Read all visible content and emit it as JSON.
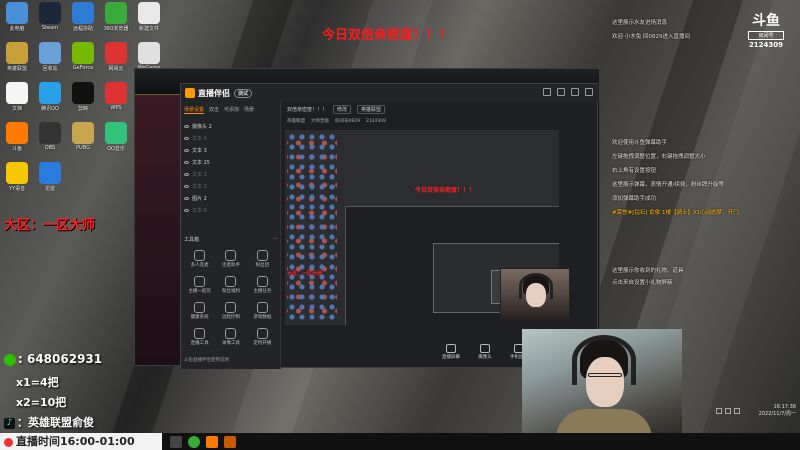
{
  "overlays": {
    "red_banner": "今日双倍亲密度！！！",
    "server_region": "大区：一区大师",
    "qq_group": ": 648062931",
    "kills_rule_1": "x1=4把",
    "kills_rule_2": "x2=10把",
    "tiktok_name": "：英雄联盟俞俊",
    "live_time": "直播时间16:00-01:00"
  },
  "desktop_icons": [
    {
      "label": "此电脑",
      "color": "#4a90d9"
    },
    {
      "label": "Steam",
      "color": "#1b2838"
    },
    {
      "label": "远程协助",
      "color": "#2d7bd4"
    },
    {
      "label": "360浏览器",
      "color": "#3aaa3a"
    },
    {
      "label": "新建文件",
      "color": "#e8e8e8"
    },
    {
      "label": "英雄联盟",
      "color": "#c8a03a"
    },
    {
      "label": "回收站",
      "color": "#6aa0d8"
    },
    {
      "label": "GeForce",
      "color": "#76b900"
    },
    {
      "label": "网易云",
      "color": "#d33"
    },
    {
      "label": "WeGame",
      "color": "#e0e0e0"
    },
    {
      "label": "文档",
      "color": "#f5f5f5"
    },
    {
      "label": "腾讯QQ",
      "color": "#2aa0e8"
    },
    {
      "label": "剪映",
      "color": "#111"
    },
    {
      "label": "WPS",
      "color": "#d33"
    },
    {
      "label": "微信",
      "color": "#2dc100"
    },
    {
      "label": "斗鱼",
      "color": "#ff7a00"
    },
    {
      "label": "OBS",
      "color": "#333"
    },
    {
      "label": "PUBG",
      "color": "#c8a650"
    },
    {
      "label": "QQ音乐",
      "color": "#31c27c"
    },
    {
      "label": "网易UU",
      "color": "#2c6ad8"
    },
    {
      "label": "YY语音",
      "color": "#f7c800"
    },
    {
      "label": "迅雷",
      "color": "#2a7ae0"
    }
  ],
  "app": {
    "logo": "直播伴侣",
    "version": "测试",
    "tabs": [
      "场景设置",
      "双击",
      "可添加",
      "场景"
    ],
    "sources": [
      {
        "label": "摄像头 2",
        "dim": false
      },
      {
        "label": "文本 4",
        "dim": true
      },
      {
        "label": "文本 3",
        "dim": false
      },
      {
        "label": "文本 25",
        "dim": false
      },
      {
        "label": "文本 1",
        "dim": true
      },
      {
        "label": "文本 2",
        "dim": true
      },
      {
        "label": "图片 2",
        "dim": false
      },
      {
        "label": "文本 6",
        "dim": true
      }
    ],
    "tools_heading": "工具箱",
    "tools": [
      "多人连麦",
      "连麦助手",
      "粉丝团",
      "主播一起玩",
      "粉丝福利",
      "主播任务",
      "健康系统",
      "远程控制",
      "游戏数据",
      "直播工具",
      "录像工具",
      "定时开播"
    ],
    "footer_tip": "斗鱼直播伴侣使用说明",
    "room_title": "双倍亲密度！！！",
    "room_tag": "修改",
    "room_category": "英雄联盟",
    "room_info": [
      "英雄联盟",
      "大师晋级",
      "房间号0829",
      "2124309"
    ],
    "stream_tools": [
      "直播屏幕",
      "摄像头",
      "手机投屏",
      "多媒体",
      "麦克风",
      "扬声器"
    ]
  },
  "chat": {
    "room_number": "2124309",
    "badge_label": "房间号",
    "logo": "斗鱼",
    "lines": [
      {
        "text": "这里展示水友进场消息",
        "cls": ""
      },
      {
        "text": "欢迎 小木兔 回0829进入直播间",
        "cls": ""
      },
      {
        "text": "欢迎使用斗鱼弹幕助手",
        "cls": ""
      },
      {
        "text": "左键拖拽调整位置，右键拖拽调整大小",
        "cls": ""
      },
      {
        "text": "右上角有设置按钮",
        "cls": ""
      },
      {
        "text": "这里展示弹幕，表情开通/续费，粉丝牌升级等",
        "cls": ""
      },
      {
        "text": "添加弹幕助手成功",
        "cls": ""
      },
      {
        "text": "#荣誉#[钻石] 俞俊 1楼【骑士】X1心动的梦：开门",
        "cls": "gold"
      },
      {
        "text": "这里展示你收到的礼物、道具",
        "cls": ""
      },
      {
        "text": "点击来自设置小礼物屏蔽",
        "cls": ""
      }
    ],
    "clock_time": "16:17:38",
    "clock_date": "2022/11/7/周一"
  }
}
